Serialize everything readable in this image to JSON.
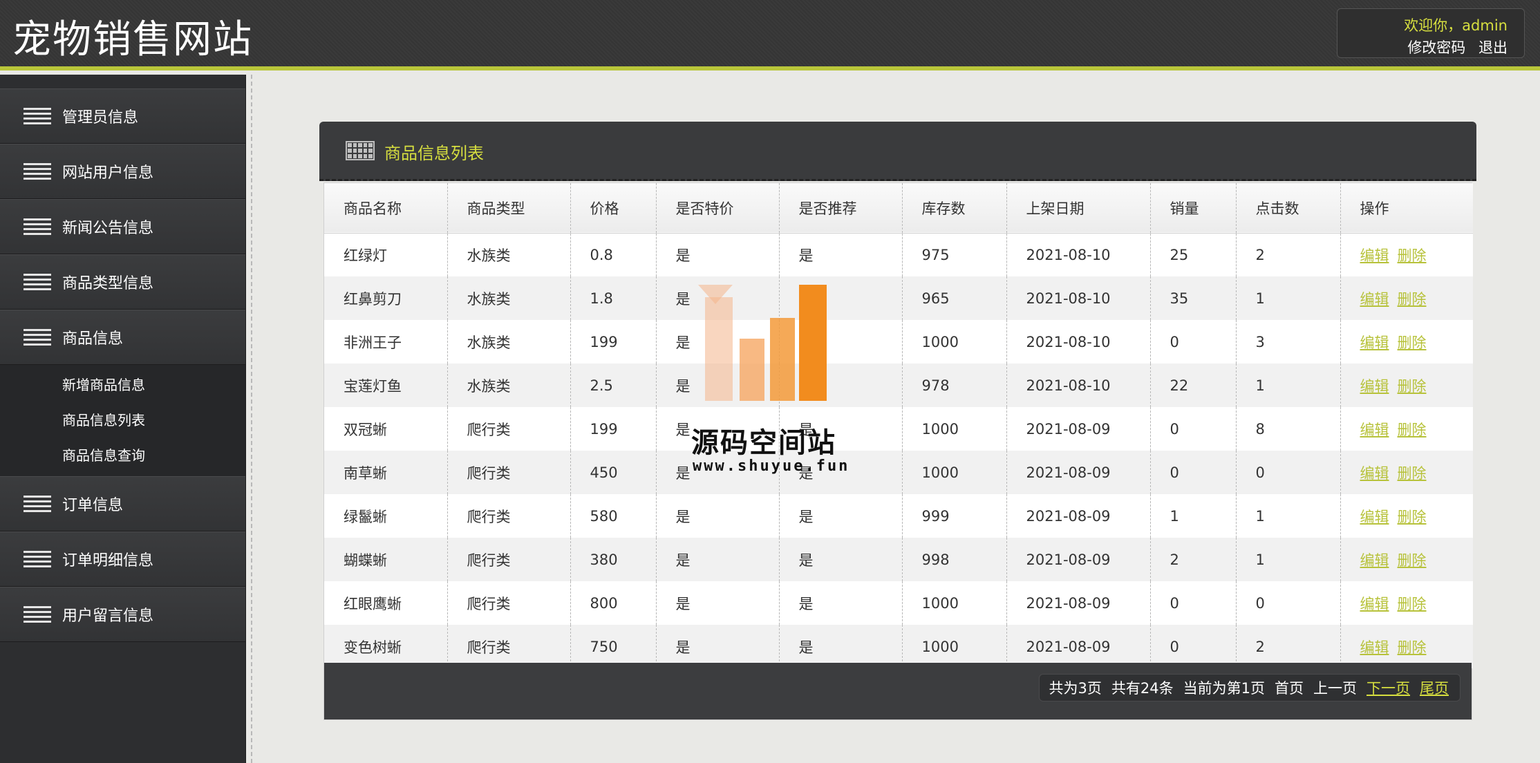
{
  "header": {
    "site_title": "宠物销售网站",
    "welcome": "欢迎你，admin",
    "change_password": "修改密码",
    "logout": "退出"
  },
  "sidebar": {
    "items": [
      {
        "label": "管理员信息",
        "icon": "menu-lines-icon"
      },
      {
        "label": "网站用户信息",
        "icon": "menu-lines-icon"
      },
      {
        "label": "新闻公告信息",
        "icon": "menu-lines-icon"
      },
      {
        "label": "商品类型信息",
        "icon": "menu-lines-icon"
      },
      {
        "label": "商品信息",
        "icon": "menu-lines-icon",
        "expanded": true,
        "subitems": [
          {
            "label": "新增商品信息"
          },
          {
            "label": "商品信息列表"
          },
          {
            "label": "商品信息查询"
          }
        ]
      },
      {
        "label": "订单信息",
        "icon": "menu-lines-icon"
      },
      {
        "label": "订单明细信息",
        "icon": "menu-lines-icon"
      },
      {
        "label": "用户留言信息",
        "icon": "menu-lines-icon"
      }
    ]
  },
  "panel": {
    "title": "商品信息列表",
    "icon": "table-grid-icon",
    "columns": [
      "商品名称",
      "商品类型",
      "价格",
      "是否特价",
      "是否推荐",
      "库存数",
      "上架日期",
      "销量",
      "点击数",
      "操作"
    ],
    "rows": [
      [
        "红绿灯",
        "水族类",
        "0.8",
        "是",
        "是",
        "975",
        "2021-08-10",
        "25",
        "2"
      ],
      [
        "红鼻剪刀",
        "水族类",
        "1.8",
        "是",
        "是",
        "965",
        "2021-08-10",
        "35",
        "1"
      ],
      [
        "非洲王子",
        "水族类",
        "199",
        "是",
        "是",
        "1000",
        "2021-08-10",
        "0",
        "3"
      ],
      [
        "宝莲灯鱼",
        "水族类",
        "2.5",
        "是",
        "是",
        "978",
        "2021-08-10",
        "22",
        "1"
      ],
      [
        "双冠蜥",
        "爬行类",
        "199",
        "是",
        "是",
        "1000",
        "2021-08-09",
        "0",
        "8"
      ],
      [
        "南草蜥",
        "爬行类",
        "450",
        "是",
        "是",
        "1000",
        "2021-08-09",
        "0",
        "0"
      ],
      [
        "绿鬣蜥",
        "爬行类",
        "580",
        "是",
        "是",
        "999",
        "2021-08-09",
        "1",
        "1"
      ],
      [
        "蝴蝶蜥",
        "爬行类",
        "380",
        "是",
        "是",
        "998",
        "2021-08-09",
        "2",
        "1"
      ],
      [
        "红眼鹰蜥",
        "爬行类",
        "800",
        "是",
        "是",
        "1000",
        "2021-08-09",
        "0",
        "0"
      ],
      [
        "变色树蜥",
        "爬行类",
        "750",
        "是",
        "是",
        "1000",
        "2021-08-09",
        "0",
        "2"
      ]
    ],
    "actions": {
      "edit": "编辑",
      "delete": "删除"
    }
  },
  "pager": {
    "total_pages": "共为3页",
    "total_records": "共有24条",
    "current": "当前为第1页",
    "first": "首页",
    "prev": "上一页",
    "next": "下一页",
    "last": "尾页"
  },
  "watermark": {
    "text": "源码空间站",
    "url": "www.shuyue.fun"
  },
  "colors": {
    "accent": "#d7df3f",
    "link": "#b7c23a",
    "header_bg": "#383838",
    "sidebar_bg": "#2d2e30",
    "watermark_orange": "#f28c1e"
  }
}
